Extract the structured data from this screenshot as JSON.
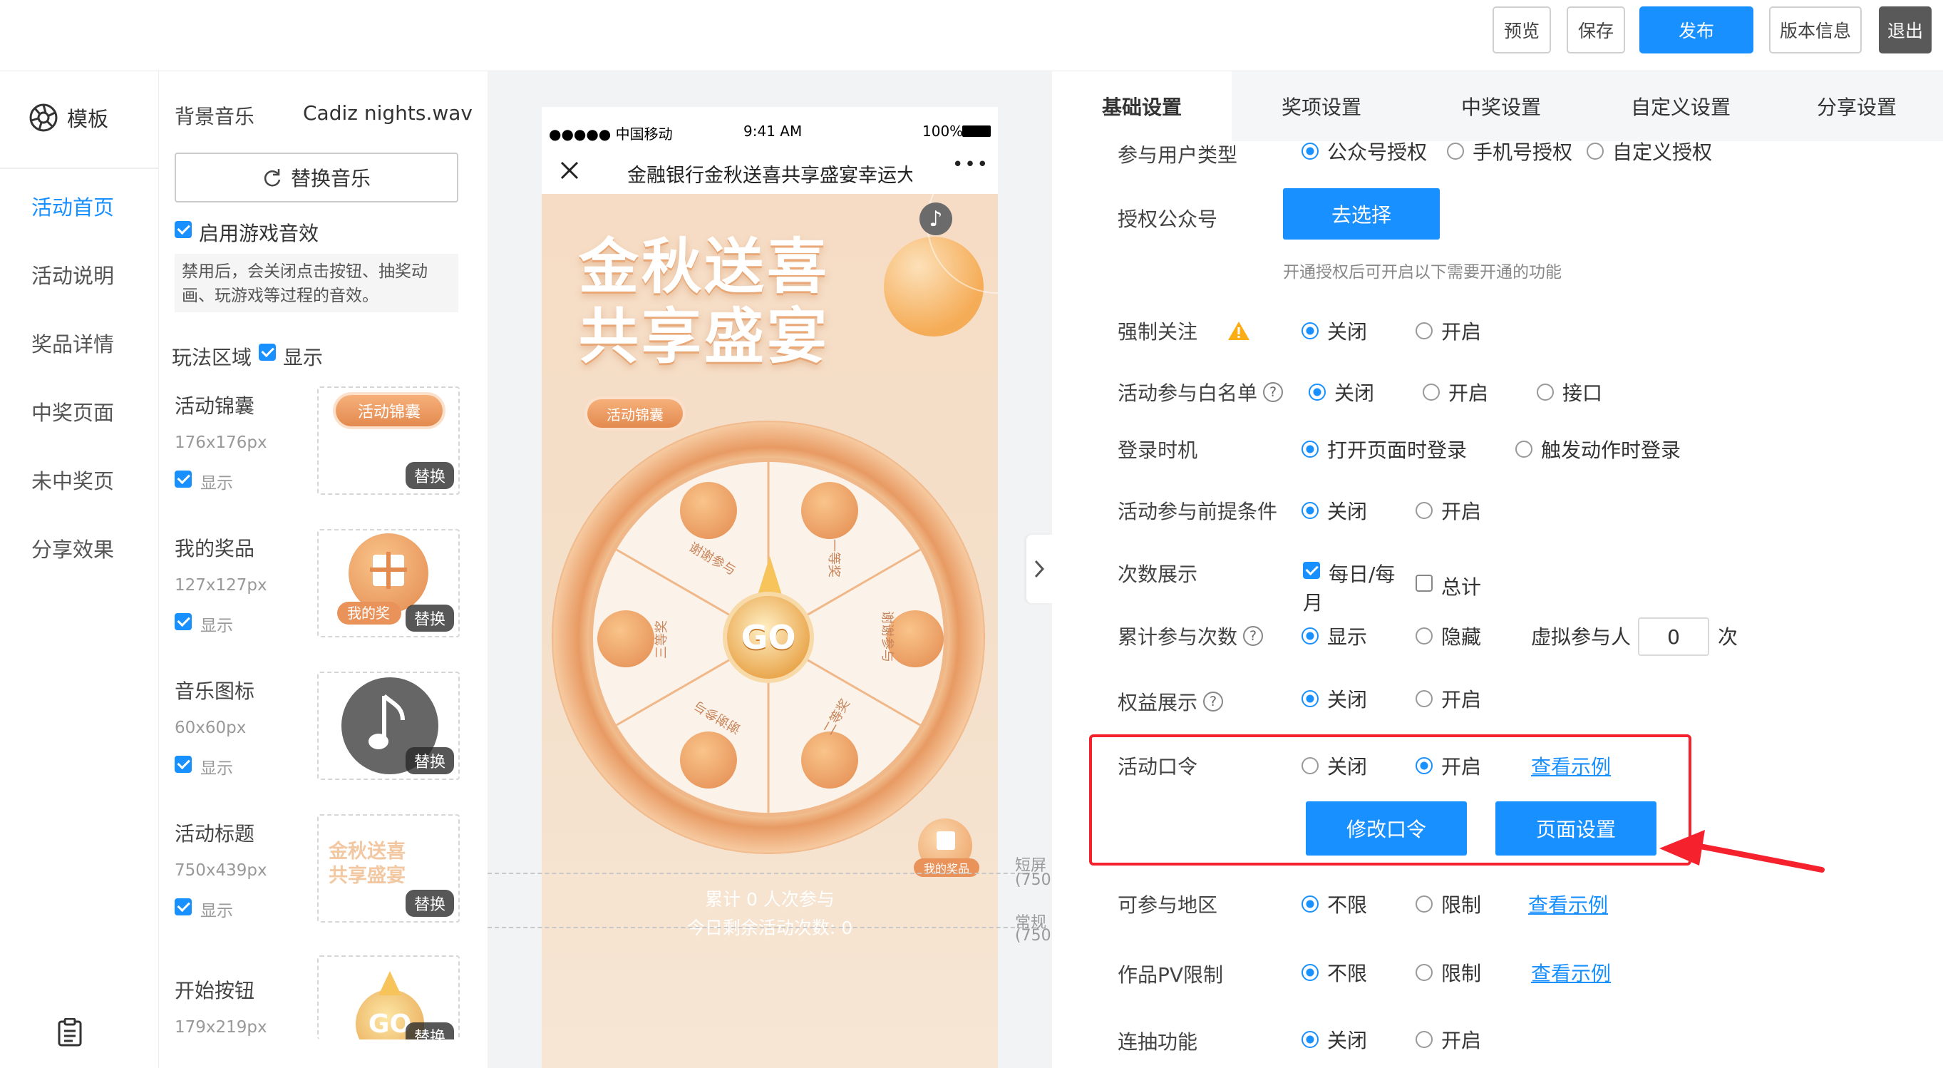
{
  "toolbar": {
    "preview": "预览",
    "save": "保存",
    "publish": "发布",
    "version": "版本信息",
    "exit": "退出",
    "colors": {
      "primary": "#1890ff",
      "exit": "#595959"
    }
  },
  "sidebar": {
    "logo_label": "模板",
    "items": [
      {
        "label": "活动首页",
        "active": true
      },
      {
        "label": "活动说明"
      },
      {
        "label": "奖品详情"
      },
      {
        "label": "中奖页面"
      },
      {
        "label": "未中奖页"
      },
      {
        "label": "分享效果"
      }
    ],
    "bottom_icon": "clipboard-icon"
  },
  "assets": {
    "music_label": "背景音乐",
    "music_file": "Cadiz nights.wav",
    "replace_music": "替换音乐",
    "sound_enable": "启用游戏音效",
    "sound_note": "禁用后，会关闭点击按钮、抽奖动画、玩游戏等过程的音效。",
    "play_area": "玩法区域",
    "play_area_show": "显示",
    "swap": "替换",
    "items": [
      {
        "name": "活动锦囊",
        "size": "176x176px",
        "show": "显示",
        "thumb_text": "活动锦囊"
      },
      {
        "name": "我的奖品",
        "size": "127x127px",
        "show": "显示",
        "thumb_text": "我的奖"
      },
      {
        "name": "音乐图标",
        "size": "60x60px",
        "show": "显示"
      },
      {
        "name": "活动标题",
        "size": "750x439px",
        "show": "显示",
        "thumb_text": "金秋送喜共享盛宴"
      },
      {
        "name": "开始按钮",
        "size": "179x219px",
        "thumb_text": "GO",
        "swap_partial": "替换"
      }
    ]
  },
  "phone": {
    "carrier": "●●●●● 中国移动",
    "time": "9:41 AM",
    "battery": "100%",
    "title": "金融银行金秋送喜共享盛宴幸运大",
    "more": "•••",
    "headline_1": "金秋送喜",
    "headline_2": "共享盛宴",
    "tips_badge": "活动锦囊",
    "go": "GO",
    "prizes": [
      "谢谢参与",
      "一等奖",
      "谢谢参与",
      "二等奖",
      "谢谢参与",
      "三等奖"
    ],
    "my_prize": "我的奖品",
    "participants": "累计 0 人次参与",
    "remaining": "今日剩余活动次数: 0",
    "short_screen": "短屏",
    "short_screen_w": "(750",
    "normal_screen": "常规",
    "normal_screen_w": "(750"
  },
  "settings": {
    "tabs": [
      {
        "label": "基础设置",
        "active": true
      },
      {
        "label": "奖项设置"
      },
      {
        "label": "中奖设置"
      },
      {
        "label": "自定义设置"
      },
      {
        "label": "分享设置"
      }
    ],
    "user_type": {
      "label": "参与用户类型",
      "options": [
        "公众号授权",
        "手机号授权",
        "自定义授权"
      ],
      "selected": 0
    },
    "auth_account": {
      "label": "授权公众号",
      "button": "去选择",
      "hint": "开通授权后可开启以下需要开通的功能"
    },
    "force_follow": {
      "label": "强制关注",
      "options": [
        "关闭",
        "开启"
      ],
      "selected": 0
    },
    "whitelist": {
      "label": "活动参与白名单",
      "options": [
        "关闭",
        "开启",
        "接口"
      ],
      "selected": 0
    },
    "login_time": {
      "label": "登录时机",
      "options": [
        "打开页面时登录",
        "触发动作时登录"
      ],
      "selected": 0
    },
    "precondition": {
      "label": "活动参与前提条件",
      "options": [
        "关闭",
        "开启"
      ],
      "selected": 0
    },
    "count_display": {
      "label": "次数展示",
      "daily_line1": "每日/每",
      "daily_line2": "月",
      "total": "总计",
      "daily_checked": true,
      "total_checked": false
    },
    "total_count": {
      "label": "累计参与次数",
      "options": [
        "显示",
        "隐藏"
      ],
      "selected": 0,
      "virtual_label": "虚拟参与人",
      "virtual_value": "0",
      "unit": "次"
    },
    "benefits": {
      "label": "权益展示",
      "options": [
        "关闭",
        "开启"
      ],
      "selected": 0
    },
    "password": {
      "label": "活动口令",
      "options": [
        "关闭",
        "开启"
      ],
      "selected": 1,
      "example": "查看示例",
      "modify": "修改口令",
      "page_settings": "页面设置"
    },
    "region": {
      "label": "可参与地区",
      "options": [
        "不限",
        "限制"
      ],
      "selected": 0,
      "example": "查看示例"
    },
    "pv_limit": {
      "label": "作品PV限制",
      "options": [
        "不限",
        "限制"
      ],
      "selected": 0,
      "example": "查看示例"
    },
    "multi_draw": {
      "label": "连抽功能",
      "options": [
        "关闭",
        "开启"
      ],
      "selected": 0
    }
  }
}
